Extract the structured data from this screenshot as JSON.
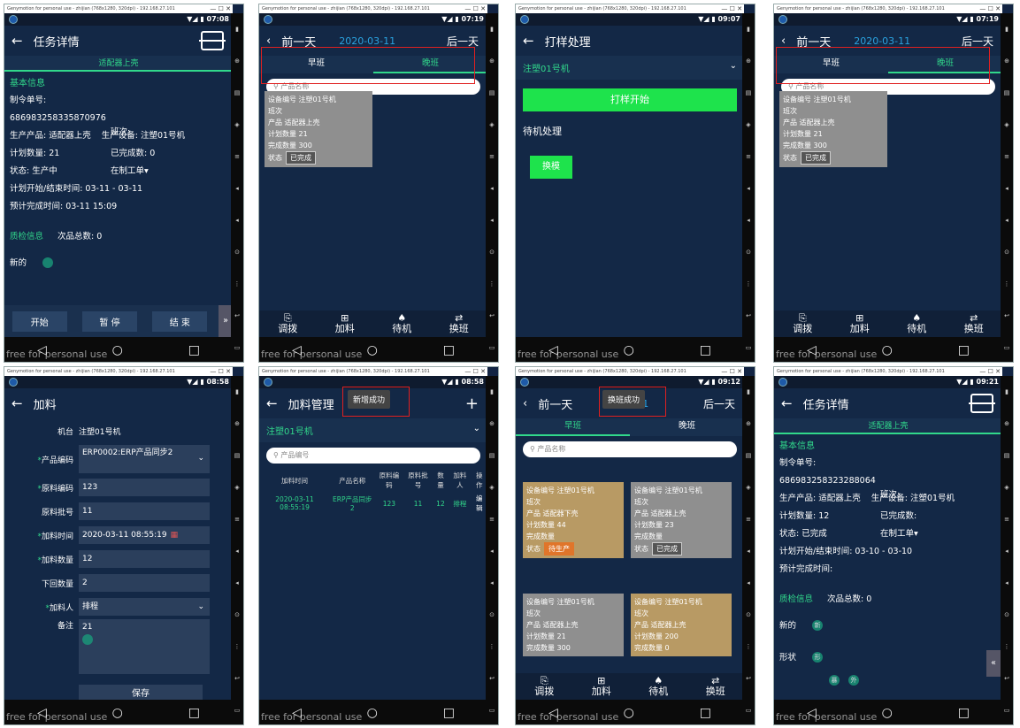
{
  "emulator_title": "Genymotion for personal use - zhijian (768x1280, 320dpi) - 192.168.27.101",
  "watermark": "free for personal use",
  "p1": {
    "time": "07:08",
    "title": "任务详情",
    "product_tab": "适配器上壳",
    "basic_info": "基本信息",
    "order_label": "制令单号:",
    "order_no": "686983258335870976",
    "shift_label": "班次:",
    "product": "生产产品: 适配器上壳",
    "device": "生产设备: 注塑01号机",
    "plan_qty": "计划数量: 21",
    "done_qty": "已完成数: 0",
    "status": "状态: 生产中",
    "order_state": "在制工单",
    "plan_time": "计划开始/结束时间: 03-11 - 03-11",
    "est_time": "预计完成时间: 03-11 15:09",
    "qc_info": "质检信息",
    "defect_total": "次品总数: 0",
    "new_label": "新的",
    "btn_start": "开始",
    "btn_pause": "暂 停",
    "btn_end": "结 束"
  },
  "p2": {
    "time": "07:19",
    "prev": "前一天",
    "date": "2020-03-11",
    "next": "后一天",
    "tab_morning": "早班",
    "tab_night": "晚班",
    "search_ph": "产品名称",
    "card": {
      "device": "设备编号 注塑01号机",
      "shift": "班次",
      "product": "产品 适配器上壳",
      "plan": "计划数量 21",
      "done": "完成数量 300",
      "status_label": "状态",
      "status": "已完成"
    },
    "nav": [
      "调拨",
      "加料",
      "待机",
      "换班"
    ]
  },
  "p3": {
    "time": "09:07",
    "title": "打样处理",
    "machine": "注塑01号机",
    "start_btn": "打样开始",
    "standby": "待机处理",
    "change_btn": "换模"
  },
  "p4": {
    "time": "07:19",
    "prev": "前一天",
    "date": "2020-03-11",
    "next": "后一天",
    "tab_morning": "早班",
    "tab_night": "晚班",
    "search_ph": "产品名称",
    "card": {
      "device": "设备编号 注塑01号机",
      "shift": "班次",
      "product": "产品 适配器上壳",
      "plan": "计划数量 21",
      "done": "完成数量 300",
      "status_label": "状态",
      "status": "已完成"
    },
    "nav": [
      "调拨",
      "加料",
      "待机",
      "换班"
    ]
  },
  "p5": {
    "time": "08:58",
    "title": "加料",
    "rows": [
      {
        "label": "机台",
        "val": "注塑01号机",
        "req": false
      },
      {
        "label": "产品编码",
        "val": "ERP0002:ERP产品同步2",
        "req": true
      },
      {
        "label": "原料编码",
        "val": "123",
        "req": true
      },
      {
        "label": "原料批号",
        "val": "11",
        "req": false
      },
      {
        "label": "加料时间",
        "val": "2020-03-11 08:55:19",
        "req": true
      },
      {
        "label": "加料数量",
        "val": "12",
        "req": true
      },
      {
        "label": "下回数量",
        "val": "2",
        "req": false
      },
      {
        "label": "加料人",
        "val": "排程",
        "req": true
      }
    ],
    "remark_label": "备注",
    "remark_val": "21",
    "save": "保存"
  },
  "p6": {
    "time": "08:58",
    "title": "加料管理",
    "toast": "新增成功",
    "machine": "注塑01号机",
    "search_ph": "产品编号",
    "cols": [
      "加料时间",
      "产品名称",
      "原料编码",
      "原料批号",
      "数量",
      "加料人",
      "操作"
    ],
    "row": [
      "2020-03-11 08:55:19",
      "ERP产品同步2",
      "123",
      "11",
      "12",
      "排程",
      "编辑"
    ]
  },
  "p7": {
    "time": "09:12",
    "prev": "前一天",
    "date_tail": "11",
    "next": "后一天",
    "toast": "换班成功",
    "tab_morning": "早班",
    "tab_night": "晚班",
    "search_ph": "产品名称",
    "cards": [
      {
        "device": "设备编号 注塑01号机",
        "shift": "班次",
        "product": "产品 适配器下壳",
        "plan": "计划数量 44",
        "done": "完成数量",
        "status": "待生产"
      },
      {
        "device": "设备编号 注塑01号机",
        "shift": "班次",
        "product": "产品 适配器上壳",
        "plan": "计划数量 23",
        "done": "完成数量",
        "status": "已完成"
      },
      {
        "device": "设备编号 注塑01号机",
        "shift": "班次",
        "product": "产品 适配器上壳",
        "plan": "计划数量 21",
        "done": "完成数量 300"
      },
      {
        "device": "设备编号 注塑01号机",
        "shift": "班次",
        "product": "产品 适配器上壳",
        "plan": "计划数量 200",
        "done": "完成数量 0"
      }
    ],
    "status_label": "状态",
    "nav": [
      "调拨",
      "加料",
      "待机",
      "换班"
    ]
  },
  "p8": {
    "time": "09:21",
    "title": "任务详情",
    "product_tab": "适配器上壳",
    "basic_info": "基本信息",
    "order_label": "制令单号:",
    "order_no": "686983258323288064",
    "shift_label": "班次:",
    "product": "生产产品: 适配器上壳",
    "device": "生产设备: 注塑01号机",
    "plan_qty": "计划数量: 12",
    "done_qty": "已完成数:",
    "status": "状态: 已完成",
    "order_state": "在制工单",
    "plan_time": "计划开始/结束时间: 03-10 - 03-10",
    "est_time": "预计完成时间:",
    "qc_info": "质检信息",
    "defect_total": "次品总数: 0",
    "new_label": "新的",
    "shape_label": "形状",
    "bubble_new": "新",
    "bubble_shape": "形",
    "bubble_other1": "暴",
    "bubble_other2": "外"
  }
}
